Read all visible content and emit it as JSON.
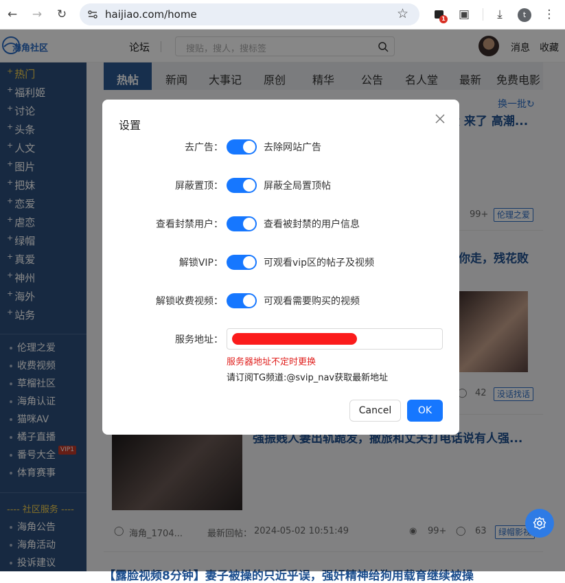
{
  "browser": {
    "url": "haijiao.com/home",
    "extension_badge": "1",
    "profile_initial": "t"
  },
  "header": {
    "logo_text": "海角社区",
    "nav_forum": "论坛",
    "search_placeholder": "搜贴，搜人，搜标签",
    "link_messages": "消息",
    "link_favorites": "收藏"
  },
  "sidebar": {
    "categories": [
      {
        "label": "热门",
        "active": true
      },
      {
        "label": "福利姬"
      },
      {
        "label": "讨论"
      },
      {
        "label": "头条"
      },
      {
        "label": "人文"
      },
      {
        "label": "图片"
      },
      {
        "label": "把妹"
      },
      {
        "label": "恋爱"
      },
      {
        "label": "虐恋"
      },
      {
        "label": "绿帽"
      },
      {
        "label": "真爱"
      },
      {
        "label": "神州"
      },
      {
        "label": "海外"
      },
      {
        "label": "站务"
      }
    ],
    "sub_items": [
      {
        "label": "伦理之爱"
      },
      {
        "label": "收费视频"
      },
      {
        "label": "草榴社区"
      },
      {
        "label": "海角认证"
      },
      {
        "label": "猫咪AV"
      },
      {
        "label": "橘子直播"
      },
      {
        "label": "番号大全",
        "badge": "VIP1"
      },
      {
        "label": "体育赛事"
      }
    ],
    "services_title": "---- 社区服务 ----",
    "services": [
      {
        "label": "海角公告"
      },
      {
        "label": "海角活动"
      },
      {
        "label": "投诉建议"
      }
    ]
  },
  "main": {
    "tabs": [
      {
        "label": "热帖",
        "active": true
      },
      {
        "label": "新闻"
      },
      {
        "label": "大事记"
      },
      {
        "label": "原创"
      },
      {
        "label": "精华"
      },
      {
        "label": "公告"
      },
      {
        "label": "名人堂"
      },
      {
        "label": "最新"
      },
      {
        "label": "免费电影"
      }
    ],
    "refresh_label": "换一批",
    "posts": [
      {
        "title_fragment": "大 来了 高潮...",
        "views": "99+",
        "tag": "伦理之爱"
      },
      {
        "title_fragment": "你走，残花败",
        "comments": "42",
        "tag": "没话找话"
      },
      {
        "title_fragment": "强振贱人妻出轨跪发，撤旅和丈夫打电话说有人强...",
        "author": "海角_1704...",
        "last_reply_label": "最新回帖：",
        "last_reply_time": "2024-05-02 10:51:49",
        "views": "99+",
        "comments": "63",
        "tag": "绿帽影视"
      },
      {
        "title_fragment": "【露脸视频8分钟】妻子被操的只近乎误，强奸精神给狗用载育继续被操"
      }
    ]
  },
  "modal": {
    "title": "设置",
    "fields": [
      {
        "label": "去广告：",
        "enabled": true,
        "description": "去除网站广告"
      },
      {
        "label": "屏蔽置顶：",
        "enabled": true,
        "description": "屏蔽全局置顶帖"
      },
      {
        "label": "查看封禁用户：",
        "enabled": true,
        "description": "查看被封禁的用户信息"
      },
      {
        "label": "解锁VIP：",
        "enabled": true,
        "description": "可观看vip区的帖子及视频"
      },
      {
        "label": "解锁收费视频：",
        "enabled": true,
        "description": "可观看需要购买的视频"
      }
    ],
    "address_label": "服务地址：",
    "address_warning": "服务器地址不定时更换",
    "address_hint": "请订阅TG频道:@svip_nav获取最新地址",
    "cancel_label": "Cancel",
    "ok_label": "OK"
  },
  "colors": {
    "sidebar_bg": "#2d4f7c",
    "active_tab_bg": "#2d5a91",
    "accent_blue": "#1677ff",
    "warning_red": "#e0201e"
  }
}
